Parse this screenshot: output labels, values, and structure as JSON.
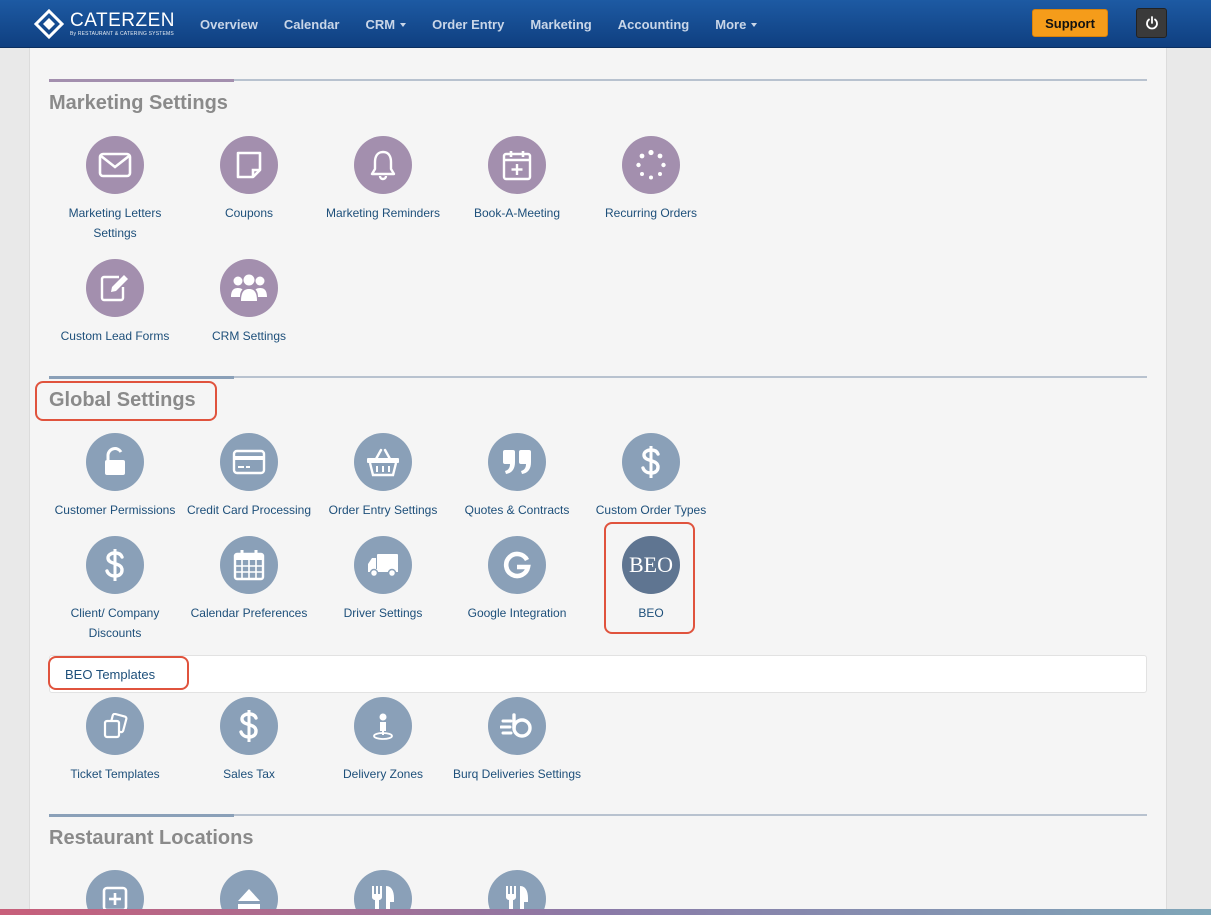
{
  "navbar": {
    "logo_name": "CATERZEN",
    "logo_sub": "By RESTAURANT & CATERING SYSTEMS",
    "items": [
      {
        "label": "Overview"
      },
      {
        "label": "Calendar"
      },
      {
        "label": "CRM",
        "dropdown": true
      },
      {
        "label": "Order Entry"
      },
      {
        "label": "Marketing"
      },
      {
        "label": "Accounting"
      },
      {
        "label": "More",
        "dropdown": true
      }
    ],
    "support_label": "Support",
    "brand_color": "#1d5aa3",
    "support_color": "#f59c1a"
  },
  "marketing_settings": {
    "title": "Marketing Settings",
    "accent_color": "#a38fae",
    "tiles": [
      {
        "label": "Marketing Letters Settings",
        "icon": "envelope-icon"
      },
      {
        "label": "Coupons",
        "icon": "note-icon"
      },
      {
        "label": "Marketing Reminders",
        "icon": "bell-icon"
      },
      {
        "label": "Book-A-Meeting",
        "icon": "calendar-plus-icon"
      },
      {
        "label": "Recurring Orders",
        "icon": "spinner-icon"
      },
      {
        "label": "Custom Lead Forms",
        "icon": "edit-icon"
      },
      {
        "label": "CRM Settings",
        "icon": "users-icon"
      }
    ]
  },
  "global_settings": {
    "title": "Global Settings",
    "accent_color": "#8aa0b8",
    "tiles": [
      {
        "label": "Customer Permissions",
        "icon": "unlock-icon"
      },
      {
        "label": "Credit Card Processing",
        "icon": "credit-card-icon"
      },
      {
        "label": "Order Entry Settings",
        "icon": "basket-icon"
      },
      {
        "label": "Quotes & Contracts",
        "icon": "quote-icon"
      },
      {
        "label": "Custom Order Types",
        "icon": "dollar-icon"
      },
      {
        "label": "Client/ Company Discounts",
        "icon": "dollar-icon"
      },
      {
        "label": "Calendar Preferences",
        "icon": "calendar-icon"
      },
      {
        "label": "Driver Settings",
        "icon": "truck-icon"
      },
      {
        "label": "Google Integration",
        "icon": "google-icon"
      },
      {
        "label": "BEO",
        "icon": "beo-icon",
        "icon_text": "BEO"
      }
    ],
    "beo_templates_label": "BEO Templates",
    "more_tiles": [
      {
        "label": "Ticket Templates",
        "icon": "copy-icon"
      },
      {
        "label": "Sales Tax",
        "icon": "dollar-icon"
      },
      {
        "label": "Delivery Zones",
        "icon": "map-pin-icon"
      },
      {
        "label": "Burq Deliveries Settings",
        "icon": "burq-icon"
      }
    ]
  },
  "restaurant_locations": {
    "title": "Restaurant Locations",
    "tiles": [
      {
        "icon": "plus-square-icon"
      },
      {
        "icon": "eject-icon"
      },
      {
        "icon": "utensils-icon"
      },
      {
        "icon": "utensils-icon"
      }
    ]
  }
}
